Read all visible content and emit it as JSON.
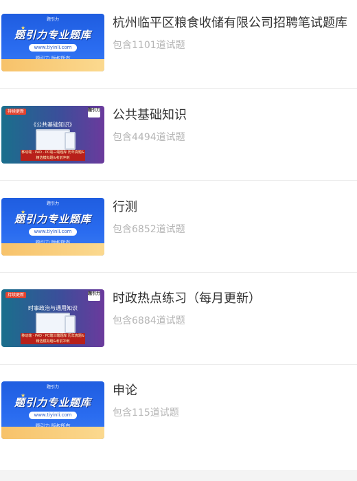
{
  "items": [
    {
      "title": "杭州临平区粮食收储有限公司招聘笔试题库",
      "count": "包含1101道试题",
      "thumb_type": "brand",
      "thumb": {
        "brand": "题引力专业题库",
        "url": "www.tiyinli.com",
        "tag": "题引力 版权所有",
        "logo": "题引力"
      }
    },
    {
      "title": "公共基础知识",
      "count": "包含4494道试题",
      "thumb_type": "study",
      "thumb": {
        "badge": "持续更新",
        "headline": "《公共基础知识》",
        "corner": "题引力",
        "strip": "移动端 · PAD · PC端三端题库\n历年真题&精选模拟题&考前冲刺"
      }
    },
    {
      "title": "行测",
      "count": "包含6852道试题",
      "thumb_type": "brand",
      "thumb": {
        "brand": "题引力专业题库",
        "url": "www.tiyinli.com",
        "tag": "题引力 版权所有",
        "logo": "题引力"
      }
    },
    {
      "title": "时政热点练习（每月更新）",
      "count": "包含6884道试题",
      "thumb_type": "study",
      "thumb": {
        "badge": "持续更新",
        "headline": "时事政治与通用知识",
        "corner": "题引力",
        "strip": "移动端 · PAD · PC端三端题库\n历年真题&精选模拟题&考前冲刺"
      }
    },
    {
      "title": "申论",
      "count": "包含115道试题",
      "thumb_type": "brand",
      "thumb": {
        "brand": "题引力专业题库",
        "url": "www.tiyinli.com",
        "tag": "题引力 版权所有",
        "logo": "题引力"
      }
    }
  ],
  "colors": {
    "title": "#333333",
    "count": "#b5b5b5",
    "divider": "#ececec",
    "brand_blue": "#2a6cf0",
    "accent_orange": "#f7c26a"
  }
}
